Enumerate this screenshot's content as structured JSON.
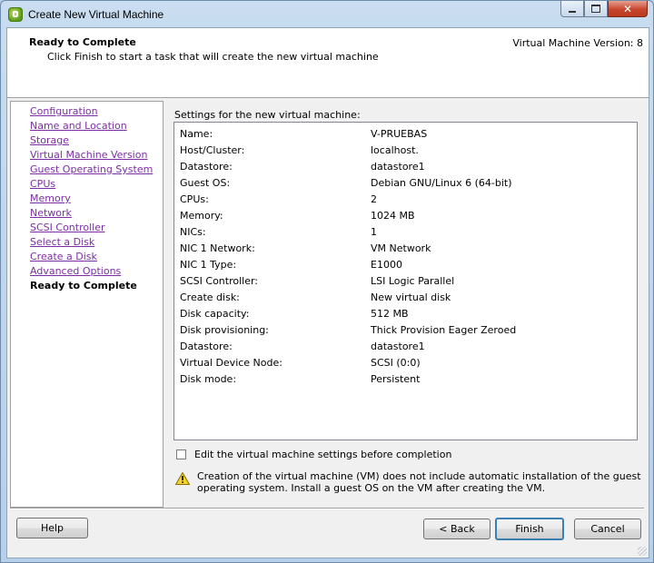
{
  "window": {
    "title": "Create New Virtual Machine",
    "close_glyph": "✕"
  },
  "header": {
    "title": "Ready to Complete",
    "subtitle": "Click Finish to start a task that will create the new virtual machine",
    "version": "Virtual Machine Version: 8"
  },
  "nav": {
    "items": [
      {
        "label": "Configuration"
      },
      {
        "label": "Name and Location"
      },
      {
        "label": "Storage"
      },
      {
        "label": "Virtual Machine Version"
      },
      {
        "label": "Guest Operating System"
      },
      {
        "label": "CPUs"
      },
      {
        "label": "Memory"
      },
      {
        "label": "Network"
      },
      {
        "label": "SCSI Controller"
      },
      {
        "label": "Select a Disk"
      },
      {
        "label": "Create a Disk"
      },
      {
        "label": "Advanced Options"
      },
      {
        "label": "Ready to Complete"
      }
    ]
  },
  "summary": {
    "label": "Settings for the new virtual machine:",
    "rows": [
      {
        "key": "Name:",
        "value": "V-PRUEBAS"
      },
      {
        "key": "Host/Cluster:",
        "value": "localhost."
      },
      {
        "key": "Datastore:",
        "value": "datastore1"
      },
      {
        "key": "Guest OS:",
        "value": "Debian GNU/Linux 6 (64-bit)"
      },
      {
        "key": "CPUs:",
        "value": "2"
      },
      {
        "key": "Memory:",
        "value": "1024 MB"
      },
      {
        "key": "NICs:",
        "value": "1"
      },
      {
        "key": "NIC 1 Network:",
        "value": "VM Network"
      },
      {
        "key": "NIC 1 Type:",
        "value": "E1000"
      },
      {
        "key": "SCSI Controller:",
        "value": "LSI Logic Parallel"
      },
      {
        "key": "Create disk:",
        "value": "New virtual disk"
      },
      {
        "key": "Disk capacity:",
        "value": "512 MB"
      },
      {
        "key": "Disk provisioning:",
        "value": "Thick Provision Eager Zeroed"
      },
      {
        "key": "Datastore:",
        "value": "datastore1"
      },
      {
        "key": "Virtual Device Node:",
        "value": "SCSI (0:0)"
      },
      {
        "key": "Disk mode:",
        "value": "Persistent"
      }
    ]
  },
  "options": {
    "edit_checkbox_label": "Edit the virtual machine settings before completion",
    "edit_checked": false
  },
  "warning": {
    "text": "Creation of the virtual machine (VM) does not include automatic installation of the guest operating system. Install a guest OS on the VM after creating the VM."
  },
  "buttons": {
    "help": "Help",
    "back": "< Back",
    "finish": "Finish",
    "cancel": "Cancel"
  },
  "colors": {
    "link_visited": "#7b2ea4",
    "default_button_border": "#3c7fb1"
  }
}
